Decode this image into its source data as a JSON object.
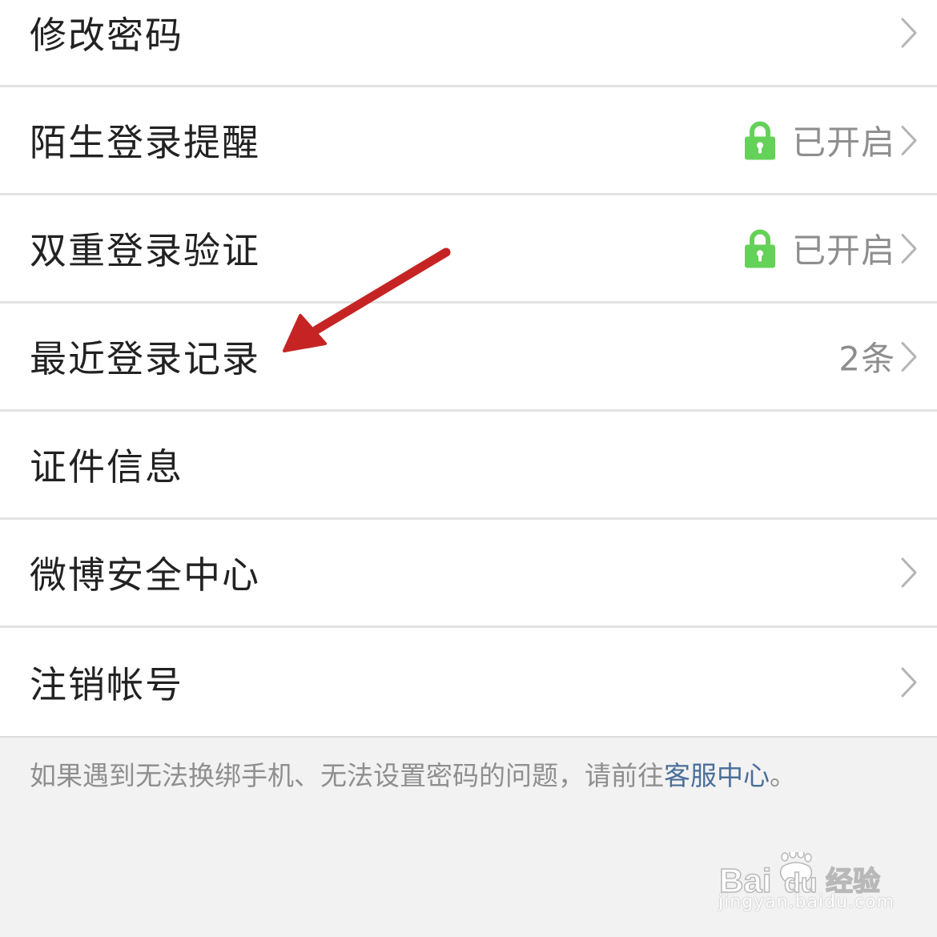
{
  "settings": {
    "items": [
      {
        "label": "修改密码",
        "value": "",
        "has_lock": false,
        "has_chevron": true
      },
      {
        "label": "陌生登录提醒",
        "value": "已开启",
        "has_lock": true,
        "has_chevron": true
      },
      {
        "label": "双重登录验证",
        "value": "已开启",
        "has_lock": true,
        "has_chevron": true
      },
      {
        "label": "最近登录记录",
        "value": "2条",
        "has_lock": false,
        "has_chevron": true
      },
      {
        "label": "证件信息",
        "value": "",
        "has_lock": false,
        "has_chevron": false
      },
      {
        "label": "微博安全中心",
        "value": "",
        "has_lock": false,
        "has_chevron": true
      },
      {
        "label": "注销帐号",
        "value": "",
        "has_lock": false,
        "has_chevron": true
      }
    ]
  },
  "footer": {
    "text": "如果遇到无法换绑手机、无法设置密码的问题，请前往",
    "link": "客服中心",
    "suffix": "。"
  },
  "watermark": {
    "brand": "Bai du 经验",
    "url": "jingyan.baidu.com"
  },
  "icons": {
    "lock": "lock-icon",
    "chevron": "chevron-right-icon",
    "annotation": "red-arrow"
  },
  "colors": {
    "lock_green": "#64d158",
    "link_blue": "#4a6f99",
    "arrow_red": "#c62424",
    "page_background": "#f2f2f2"
  }
}
